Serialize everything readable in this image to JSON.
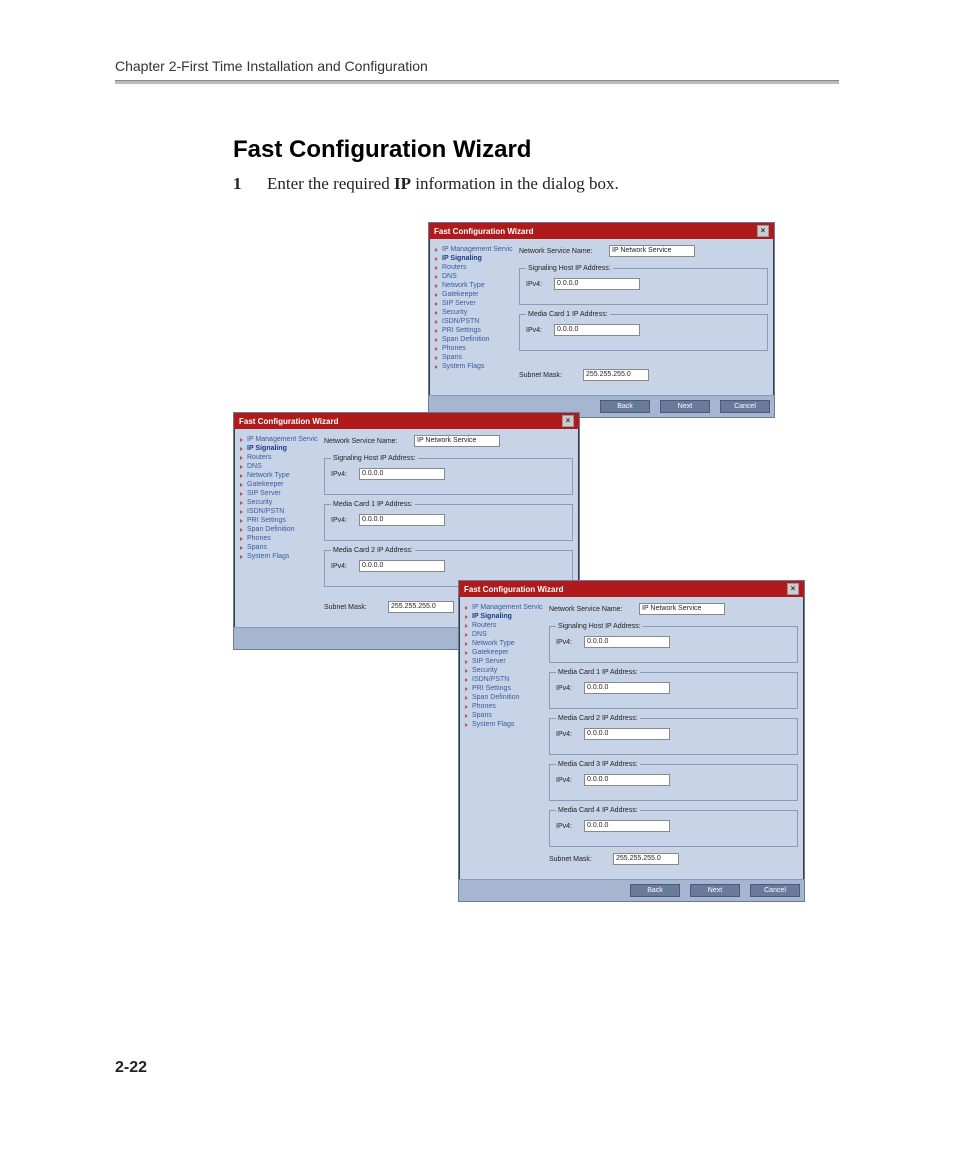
{
  "doc": {
    "chapter_header": "Chapter 2-First Time Installation and Configuration",
    "section_title": "Fast Configuration Wizard",
    "step_number": "1",
    "step_prefix": "Enter the required ",
    "step_bold": "IP",
    "step_suffix": " information in the dialog box.",
    "page_number": "2-22"
  },
  "wizard": {
    "title": "Fast Configuration Wizard",
    "close_glyph": "×",
    "sidebar": [
      "IP Management Service",
      "IP Signaling",
      "Routers",
      "DNS",
      "Network Type",
      "Gatekeeper",
      "SIP Server",
      "Security",
      "ISDN/PSTN",
      "PRI Settings",
      "Span Definition",
      "Phones",
      "Spans",
      "System Flags"
    ],
    "labels": {
      "network_service": "Network Service Name:",
      "signaling_host": "Signaling Host IP Address:",
      "media1": "Media Card 1 IP Address:",
      "media2": "Media Card 2 IP Address:",
      "media3": "Media Card 3 IP Address:",
      "media4": "Media Card 4 IP Address:",
      "ipv4": "IPv4:",
      "subnet": "Subnet Mask:"
    },
    "values": {
      "network_service": "IP Network Service",
      "default_ip": "0.0.0.0",
      "subnet": "255.255.255.0"
    },
    "buttons": {
      "back": "Back",
      "next": "Next",
      "cancel": "Cancel"
    }
  }
}
